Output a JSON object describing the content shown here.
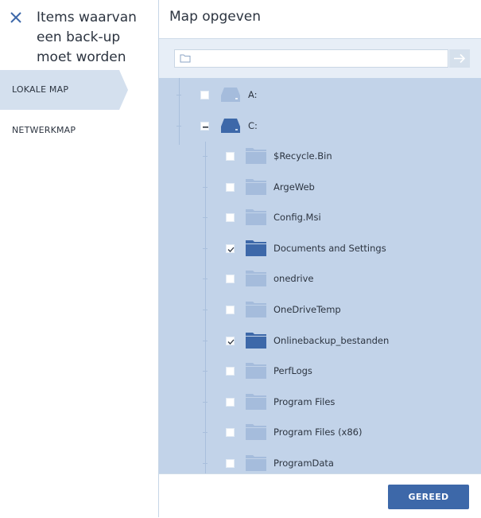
{
  "colors": {
    "accent": "#3d68a9",
    "selected_nav": "#d4e0ee",
    "tree_background": "#c2d3e9",
    "folder_inactive": "#a5bcdc",
    "folder_selected": "#3d68a9"
  },
  "sidebar": {
    "title": "Items waarvan een back-up moet worden gemaakt",
    "close_icon": "close-icon",
    "items": [
      {
        "label": "LOKALE MAP",
        "selected": true
      },
      {
        "label": "NETWERKMAP",
        "selected": false
      }
    ]
  },
  "main": {
    "title": "Map opgeven",
    "path_input": {
      "value": "",
      "placeholder": ""
    },
    "go_icon": "arrow-right-icon",
    "tree": {
      "drives": [
        {
          "label": "A:",
          "expanded": false,
          "checked": false,
          "icon": "drive-icon"
        },
        {
          "label": "C:",
          "expanded": true,
          "checked": "partial",
          "icon": "drive-icon",
          "children": [
            {
              "label": "$Recycle.Bin",
              "checked": false
            },
            {
              "label": "ArgeWeb",
              "checked": false
            },
            {
              "label": "Config.Msi",
              "checked": false
            },
            {
              "label": "Documents and Settings",
              "checked": true
            },
            {
              "label": "onedrive",
              "checked": false
            },
            {
              "label": "OneDriveTemp",
              "checked": false
            },
            {
              "label": "Onlinebackup_bestanden",
              "checked": true
            },
            {
              "label": "PerfLogs",
              "checked": false
            },
            {
              "label": "Program Files",
              "checked": false
            },
            {
              "label": "Program Files (x86)",
              "checked": false
            },
            {
              "label": "ProgramData",
              "checked": false
            }
          ]
        }
      ]
    }
  },
  "footer": {
    "done_label": "GEREED"
  }
}
